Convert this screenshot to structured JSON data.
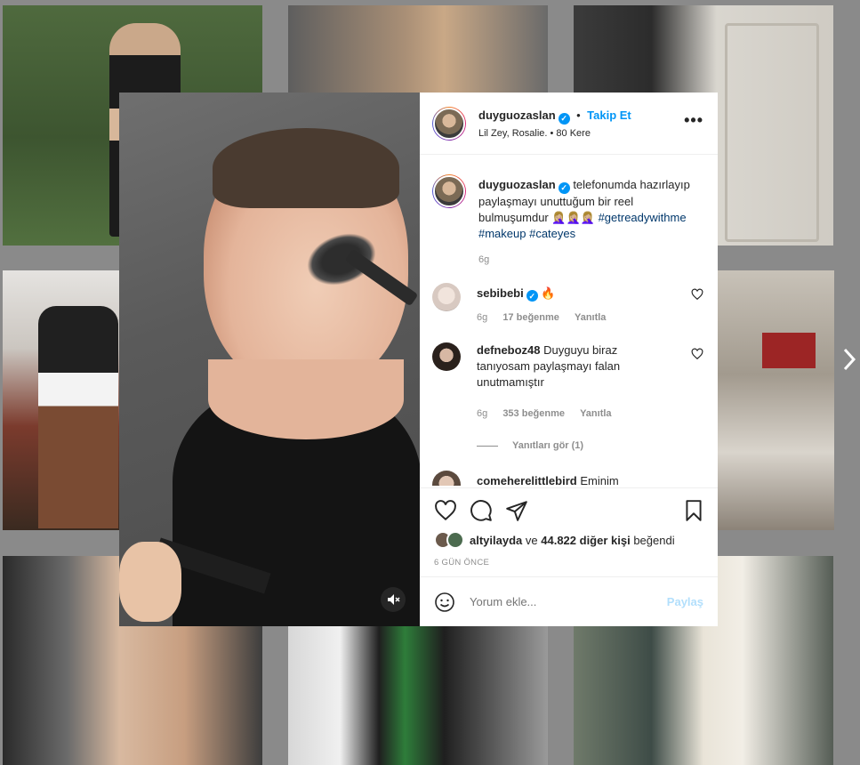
{
  "post": {
    "username": "duyguozaslan",
    "follow_label": "Takip Et",
    "audio": "Lil Zey, Rosalie.",
    "plays": "80 Kere",
    "caption_line": "telefonumda hazırlayıp paylaşmayı unuttuğum bir reel bulmuşumdur 🤦🏼‍♀️🤦🏼‍♀️🤦🏼‍♀️",
    "hashtags": "#getreadywithme #makeup #cateyes",
    "caption_time": "6g"
  },
  "comments": [
    {
      "username": "sebibebi",
      "text": "🔥",
      "time": "6g",
      "likes": "17 beğenme",
      "reply": "Yanıtla"
    },
    {
      "username": "defneboz48",
      "text": "Duyguyu biraz tanıyosam paylaşmayı falan unutmamıştır",
      "time": "6g",
      "likes": "353 beğenme",
      "reply": "Yanıtla",
      "view_replies": "Yanıtları gör (1)"
    },
    {
      "username": "comeherelittlebird",
      "text": "Eminim"
    }
  ],
  "engagement": {
    "liked_by": "altyilayda",
    "and_text": "ve",
    "others": "44.822 diğer kişi",
    "liked_suffix": "beğendi",
    "date": "6 GÜN ÖNCE"
  },
  "comment_box": {
    "placeholder": "Yorum ekle...",
    "post_label": "Paylaş"
  },
  "icons": {
    "more": "more-options-icon",
    "like": "heart-icon",
    "comment": "comment-icon",
    "share": "share-icon",
    "save": "bookmark-icon",
    "emoji": "emoji-icon",
    "mute": "muted-speaker-icon",
    "next": "chevron-right-icon"
  }
}
